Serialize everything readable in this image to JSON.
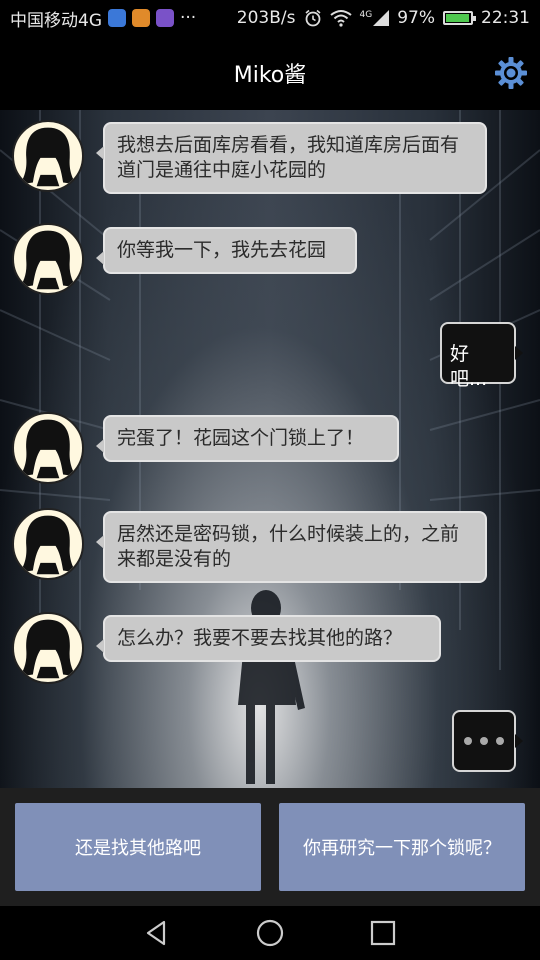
{
  "status_bar": {
    "carrier": "中国移动4G",
    "more": "···",
    "speed": "203B/s",
    "net_type": "4G",
    "battery": "97%",
    "battery_level": 0.97,
    "time": "22:31"
  },
  "header": {
    "title": "Miko酱"
  },
  "messages": [
    {
      "side": "left",
      "text": "我想去后面库房看看，我知道库房后面有道门是通往中庭小花园的"
    },
    {
      "side": "left",
      "text": "你等我一下，我先去花园"
    },
    {
      "side": "right",
      "text": "好吧..."
    },
    {
      "side": "left",
      "text": "完蛋了！花园这个门锁上了！"
    },
    {
      "side": "left",
      "text": "居然还是密码锁，什么时候装上的，之前来都是没有的"
    },
    {
      "side": "left",
      "text": "怎么办？我要不要去找其他的路？"
    }
  ],
  "choices": [
    {
      "label": "还是找其他路吧"
    },
    {
      "label": "你再研究一下那个锁呢？"
    }
  ],
  "colors": {
    "choice_bg": "#8090b8",
    "bubble_left": "#c9c9c9",
    "bubble_right": "#111111",
    "gear": "#5b8fd6"
  }
}
